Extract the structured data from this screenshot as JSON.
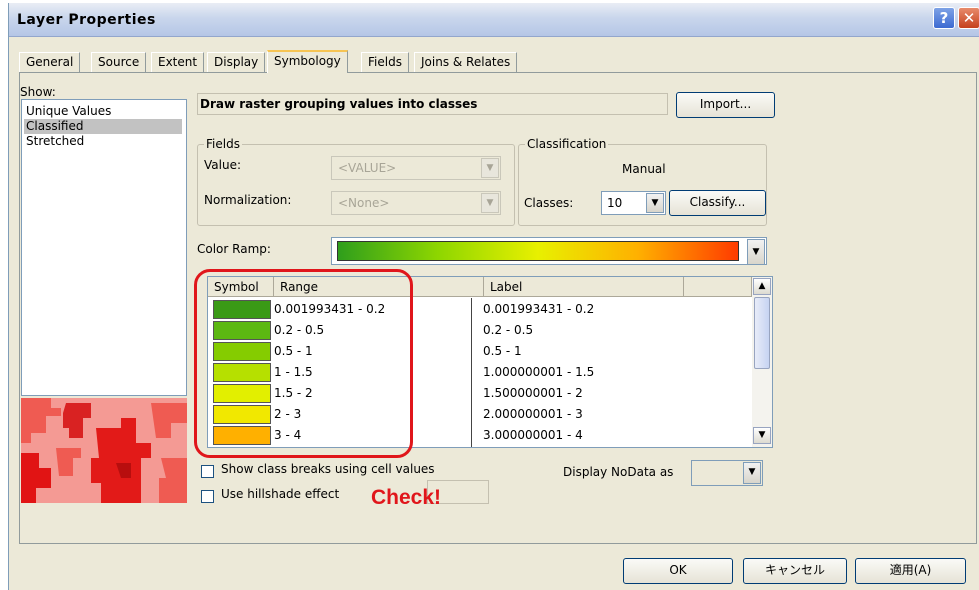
{
  "window": {
    "title": "Layer Properties",
    "help_glyph": "?",
    "close_glyph": "✕"
  },
  "tabs": [
    "General",
    "Source",
    "Extent",
    "Display",
    "Symbology",
    "Fields",
    "Joins & Relates"
  ],
  "active_tab": "Symbology",
  "show": {
    "label": "Show:",
    "items": [
      "Unique Values",
      "Classified",
      "Stretched"
    ],
    "selected": "Classified"
  },
  "description": "Draw raster grouping values into classes",
  "import_button": "Import...",
  "fields": {
    "title": "Fields",
    "value_label": "Value:",
    "value_selected": "<VALUE>",
    "normalization_label": "Normalization:",
    "normalization_selected": "<None>"
  },
  "classification": {
    "title": "Classification",
    "method": "Manual",
    "classes_label": "Classes:",
    "classes_value": "10",
    "classify_button": "Classify..."
  },
  "color_ramp": {
    "label": "Color Ramp:",
    "colors": [
      "#2f9e1c",
      "#8ed600",
      "#e8f000",
      "#ffb000",
      "#ff3b00"
    ]
  },
  "class_table": {
    "headers": {
      "symbol": "Symbol",
      "range": "Range",
      "label": "Label"
    },
    "rows": [
      {
        "color": "#3a9a16",
        "range": "0.001993431 - 0.2",
        "label": "0.001993431 - 0.2"
      },
      {
        "color": "#5cb812",
        "range": "0.2 - 0.5",
        "label": "0.2 - 0.5"
      },
      {
        "color": "#85cc00",
        "range": "0.5 - 1",
        "label": "0.5 - 1"
      },
      {
        "color": "#b6e000",
        "range": "1 - 1.5",
        "label": "1.000000001 - 1.5"
      },
      {
        "color": "#e2ef00",
        "range": "1.5 - 2",
        "label": "1.500000001 - 2"
      },
      {
        "color": "#f1e800",
        "range": "2 - 3",
        "label": "2.000000001 - 3"
      },
      {
        "color": "#ffb000",
        "range": "3 - 4",
        "label": "3.000000001 - 4"
      }
    ]
  },
  "options": {
    "show_class_breaks": "Show class breaks using cell values",
    "use_hillshade": "Use hillshade effect",
    "display_nodata": "Display NoData as"
  },
  "annotation": {
    "check": "Check!"
  },
  "dialog_buttons": {
    "ok": "OK",
    "cancel": "キャンセル",
    "apply": "適用(A)"
  }
}
